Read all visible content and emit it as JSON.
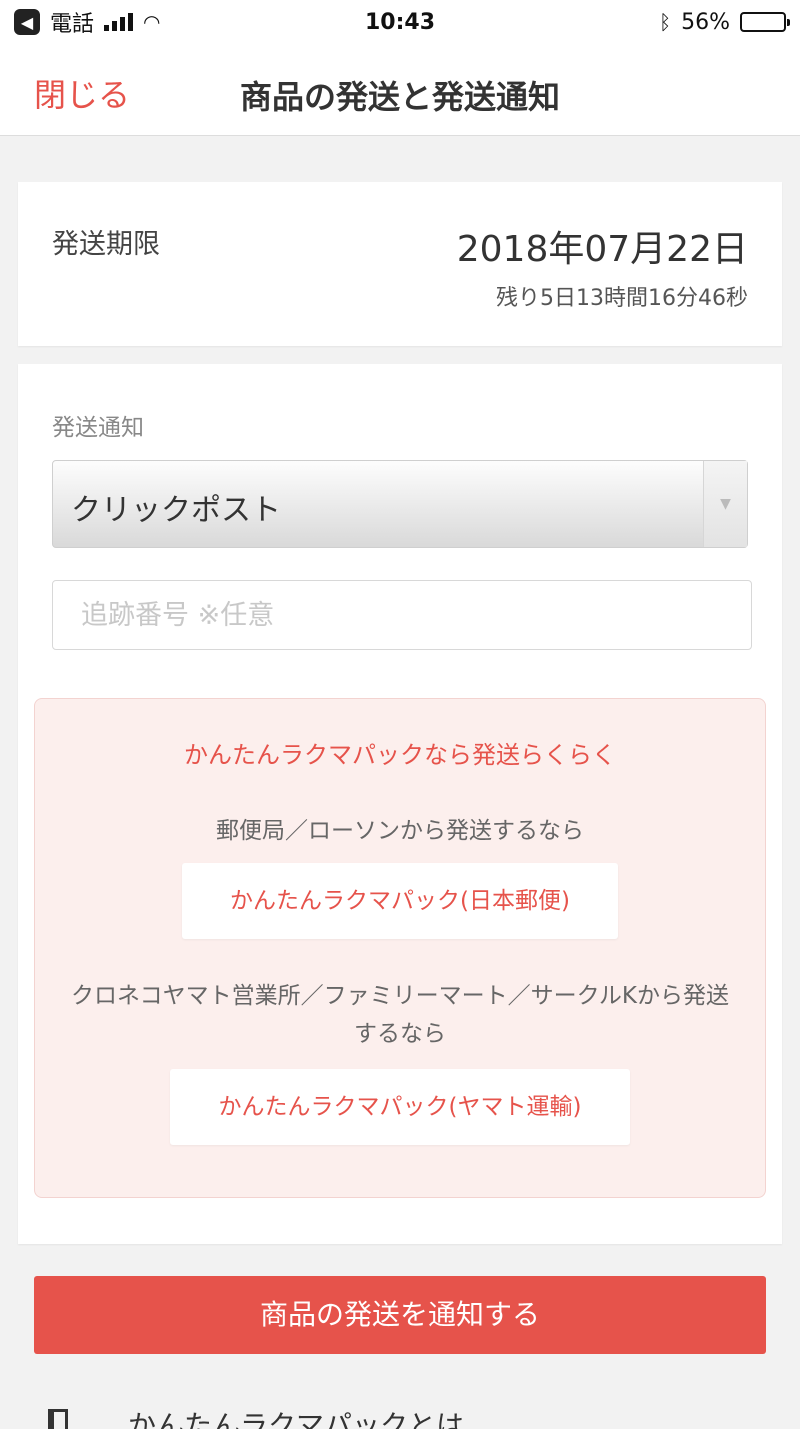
{
  "status_bar": {
    "back_app": "電話",
    "time": "10:43",
    "battery": "56%",
    "battery_level": 0.56
  },
  "nav": {
    "close": "閉じる",
    "title": "商品の発送と発送通知"
  },
  "deadline": {
    "label": "発送期限",
    "date": "2018年07月22日",
    "remaining": "残り5日13時間16分46秒"
  },
  "notify": {
    "label": "発送通知",
    "method_selected": "クリックポスト",
    "tracking_placeholder": "追跡番号 ※任意",
    "promo": {
      "title": "かんたんラクマパックなら発送らくらく",
      "sub_japanpost": "郵便局／ローソンから発送するなら",
      "btn_japanpost": "かんたんラクマパック(日本郵便)",
      "sub_yamato": "クロネコヤマト営業所／ファミリーマート／サークルKから発送するなら",
      "btn_yamato": "かんたんラクマパック(ヤマト運輸)"
    }
  },
  "submit_label": "商品の発送を通知する",
  "footer_link": "かんたんラクマパックとは"
}
